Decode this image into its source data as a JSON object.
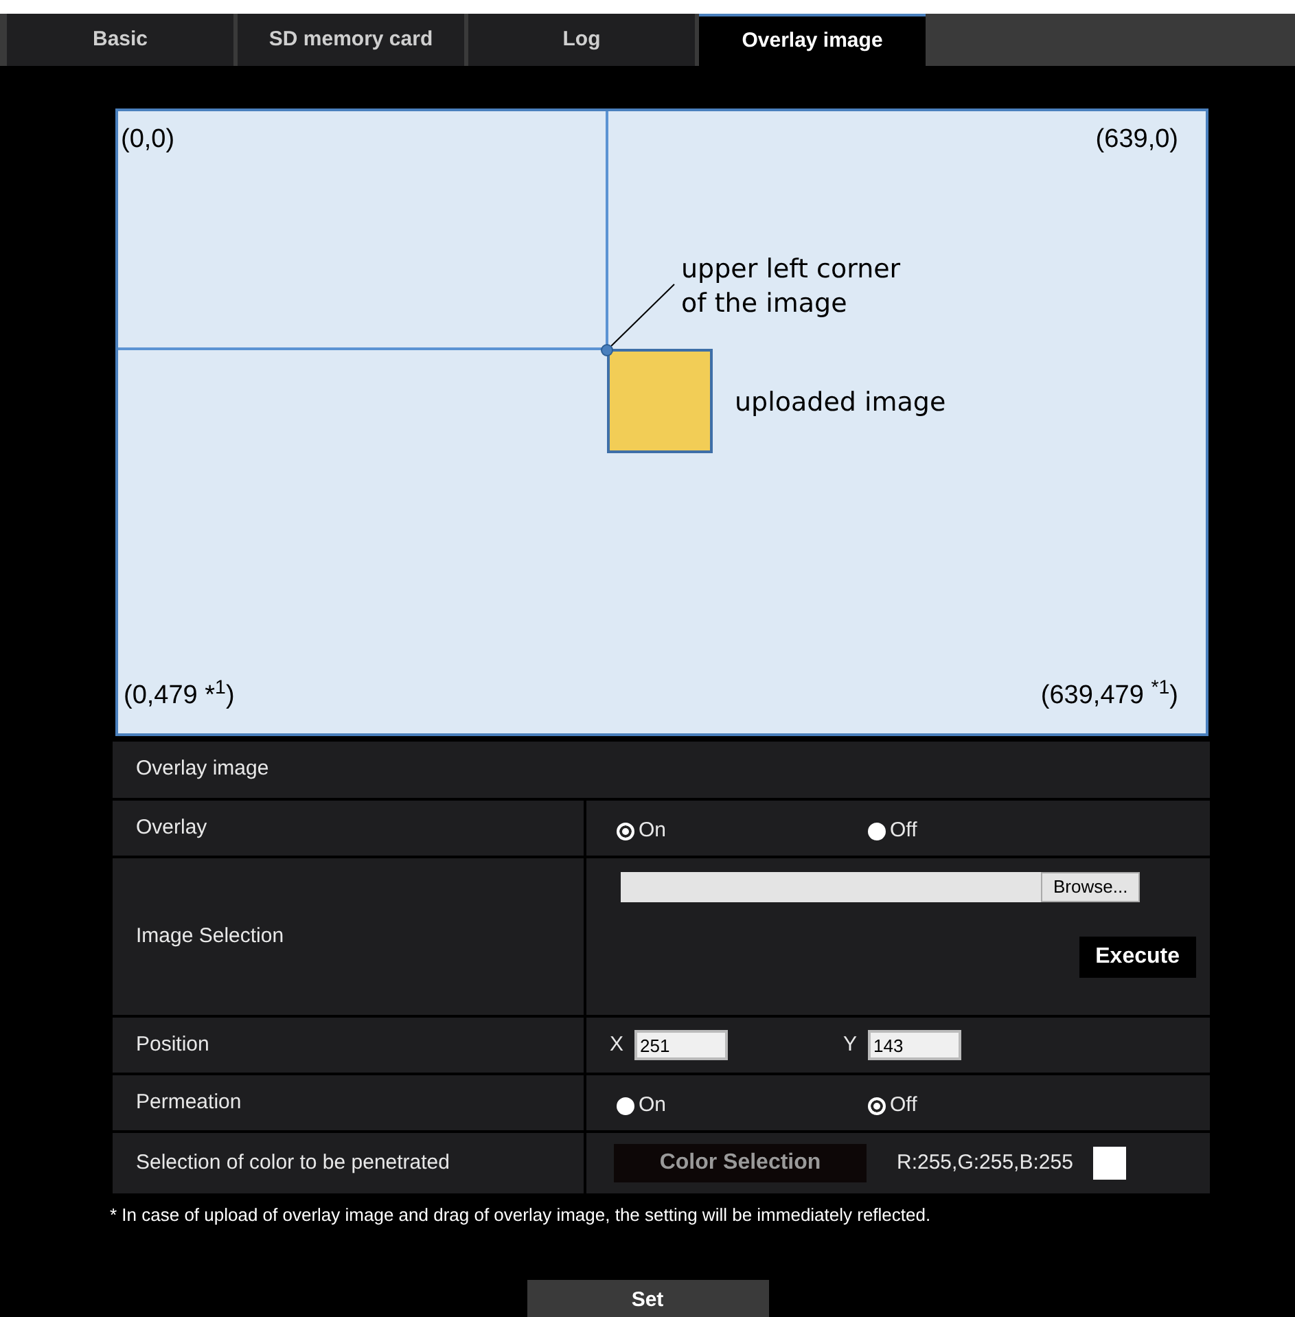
{
  "tabs": [
    {
      "label": "Basic",
      "selected": false
    },
    {
      "label": "SD memory card",
      "selected": false
    },
    {
      "label": "Log",
      "selected": false
    },
    {
      "label": "Overlay image",
      "selected": true
    }
  ],
  "diagram": {
    "corner_top_left": "(0,0)",
    "corner_top_right": "(639,0)",
    "corner_bottom_left": "(0,479 *$^{1}$)",
    "corner_bottom_right": "(639,479 $^{*1}$)",
    "callout": "upper left corner\nof the image",
    "image_label": "uploaded image"
  },
  "section_title": "Overlay image",
  "rows": [
    {
      "kind": "radio",
      "label": "Overlay",
      "options": [
        {
          "label": "On",
          "selected": true
        },
        {
          "label": "Off",
          "selected": false
        }
      ]
    },
    {
      "kind": "file",
      "label": "Image Selection",
      "browse": "Browse...",
      "execute": "Execute"
    },
    {
      "kind": "position",
      "label": "Position",
      "x_label": "X",
      "x_value": "251",
      "y_label": "Y",
      "y_value": "143"
    },
    {
      "kind": "radio",
      "label": "Permeation",
      "options": [
        {
          "label": "On",
          "selected": false
        },
        {
          "label": "Off",
          "selected": true
        }
      ]
    },
    {
      "kind": "color",
      "label": "Selection of color to be penetrated",
      "button": "Color Selection",
      "reading": "R:255,G:255,B:255",
      "color": "#ffffff"
    }
  ],
  "note": "* In case of upload of overlay image and drag of overlay image, the setting will be immediately reflected.",
  "set_button": "Set"
}
